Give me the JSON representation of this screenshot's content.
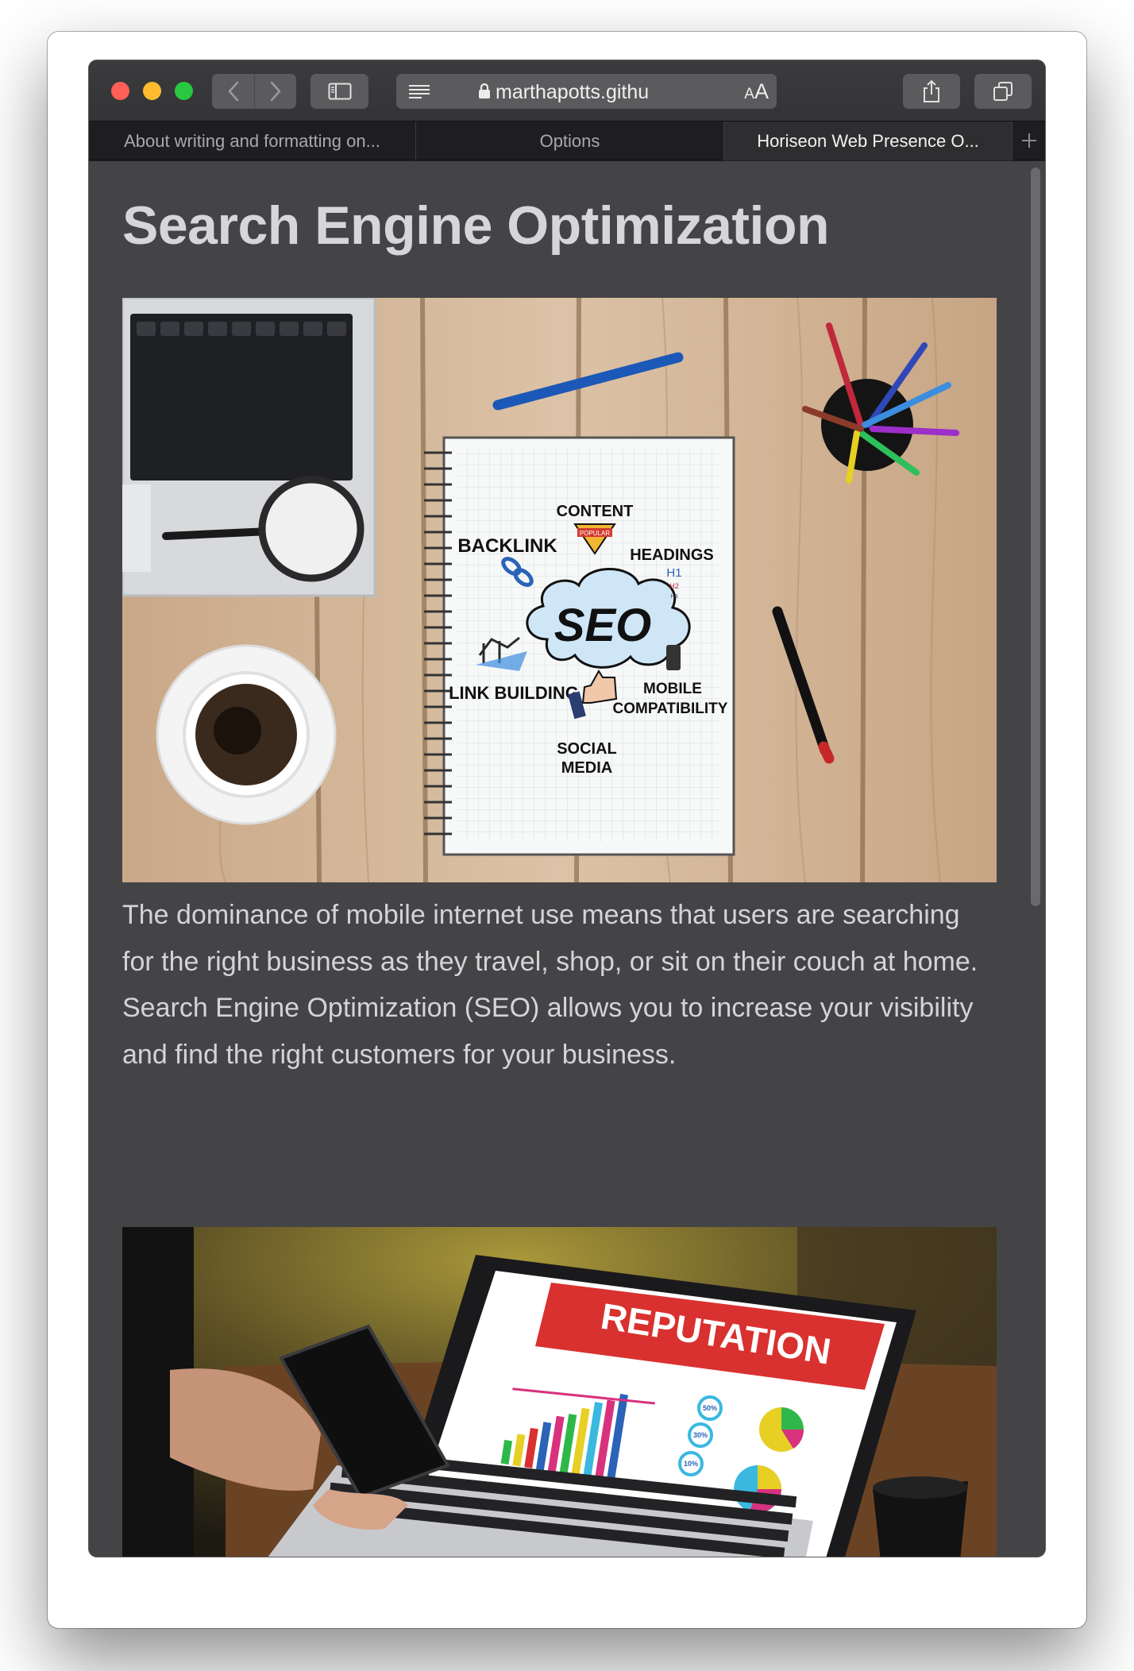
{
  "browser": {
    "url": "marthapotts.githu",
    "aa_label": "AA",
    "tabs": [
      {
        "label": "About writing and formatting on..."
      },
      {
        "label": "Options"
      },
      {
        "label": "Horiseon Web Presence O..."
      }
    ]
  },
  "page": {
    "title": "Search Engine Optimization",
    "paragraph": "The dominance of mobile internet use means that users are searching for the right business as they travel, shop, or sit on their couch at home. Search Engine Optimization (SEO) allows you to increase your visibility and find the right customers for your business.",
    "seo_image": {
      "labels": {
        "content": "CONTENT",
        "popular": "POPULAR",
        "backlink": "BACKLINK",
        "headings": "HEADINGS",
        "h1": "H1",
        "h2": "H2",
        "h3": "H3",
        "seo": "SEO",
        "link_building": "LINK BUILDING",
        "mobile": "MOBILE",
        "compatibility": "COMPATIBILITY",
        "social": "SOCIAL",
        "media": "MEDIA"
      }
    },
    "reputation_image": {
      "banner": "REPUTATION",
      "pct_1": "50%",
      "pct_2": "30%",
      "pct_3": "10%"
    }
  },
  "colors": {
    "page_bg": "#444447",
    "title": "#d6d6d8",
    "text": "#d4d4d6",
    "close": "#fe5f57",
    "minimize": "#febc2e",
    "zoom": "#28c840"
  }
}
